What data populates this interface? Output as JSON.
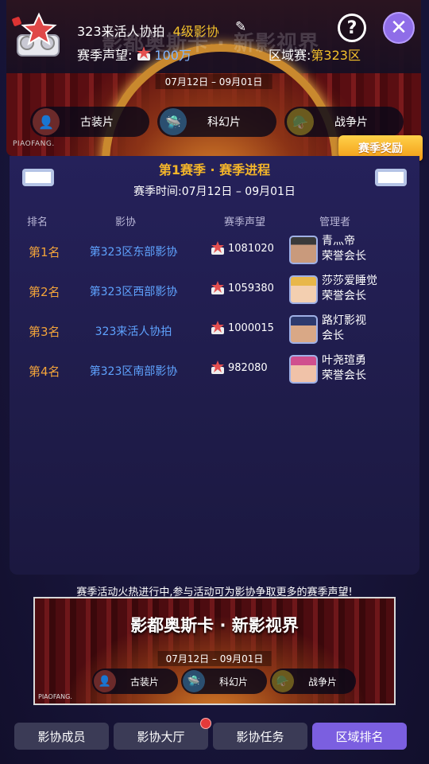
{
  "header": {
    "guild_name": "323来活人协拍",
    "guild_level": "4级影协",
    "fame_label": "赛季声望:",
    "fame_value": "100万",
    "region_label": "区域赛:",
    "region_value": "第323区",
    "reward_button": "赛季奖励"
  },
  "banner": {
    "title": "影都奥斯卡 · 新影视界",
    "date": "07月12日 – 09月01日",
    "watermark": "PIAOFANG.",
    "genres": [
      {
        "label": "古装片",
        "icon": "ancient-figure-icon",
        "color": "#6b2a2a"
      },
      {
        "label": "科幻片",
        "icon": "ufo-icon",
        "color": "#2b4f70"
      },
      {
        "label": "战争片",
        "icon": "soldier-icon",
        "color": "#6b5a1e"
      }
    ]
  },
  "season": {
    "title": "第1赛季 · 赛季进程",
    "time": "赛季时间:07月12日 – 09月01日"
  },
  "table": {
    "headers": [
      "排名",
      "影协",
      "赛季声望",
      "管理者"
    ],
    "rows": [
      {
        "rank": "第1名",
        "guild": "第323区东部影协",
        "fame": "1081020",
        "manager_name": "青灬帝",
        "manager_role": "荣誉会长",
        "avatar_color": "#8c6a52"
      },
      {
        "rank": "第2名",
        "guild": "第323区西部影协",
        "fame": "1059380",
        "manager_name": "莎莎爱睡觉",
        "manager_role": "荣誉会长",
        "avatar_color": "#e2b24e"
      },
      {
        "rank": "第3名",
        "guild": "323来活人协拍",
        "fame": "1000015",
        "manager_name": "路灯影视",
        "manager_role": "会长",
        "avatar_color": "#3d4f8c"
      },
      {
        "rank": "第4名",
        "guild": "第323区南部影协",
        "fame": "982080",
        "manager_name": "叶尧瑄勇",
        "manager_role": "荣誉会长",
        "avatar_color": "#c45a8a"
      }
    ]
  },
  "promo": {
    "text": "赛季活动火热进行中,参与活动可为影协争取更多的赛季声望!",
    "poster_title": "影都奥斯卡 · 新影视界",
    "poster_date": "07月12日 – 09月01日",
    "poster_watermark": "PIAOFANG."
  },
  "tabs": [
    {
      "label": "影协成员",
      "active": false,
      "badge": false
    },
    {
      "label": "影协大厅",
      "active": false,
      "badge": true
    },
    {
      "label": "影协任务",
      "active": false,
      "badge": false
    },
    {
      "label": "区域排名",
      "active": true,
      "badge": false
    }
  ]
}
